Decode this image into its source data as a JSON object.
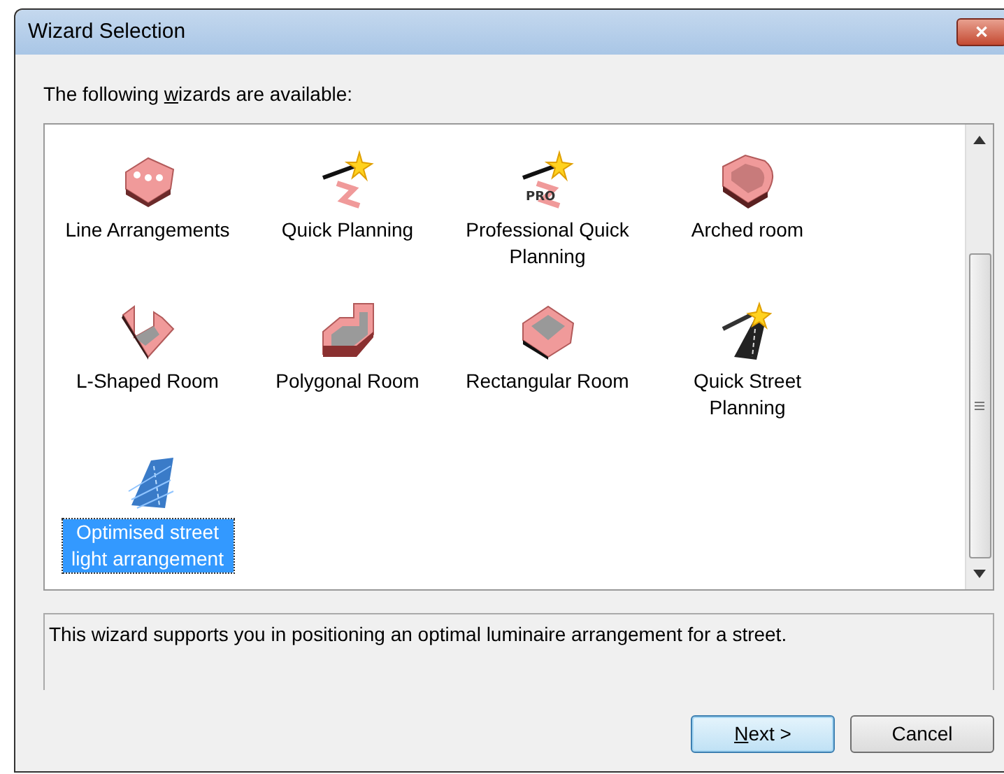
{
  "window": {
    "title": "Wizard Selection",
    "close": "✕"
  },
  "prompt": {
    "before": "The following ",
    "key": "w",
    "after": "izards are available:"
  },
  "wizards": [
    {
      "label": "Line Arrangements",
      "kind": "lit-box",
      "selected": false
    },
    {
      "label": "Quick Planning",
      "kind": "wand",
      "selected": false
    },
    {
      "label": "Professional Quick Planning",
      "kind": "wand",
      "badge": "PRO",
      "selected": false
    },
    {
      "label": "Arched room",
      "kind": "arched-room",
      "selected": false
    },
    {
      "label": "L-Shaped Room",
      "kind": "l-room",
      "selected": false
    },
    {
      "label": "Polygonal Room",
      "kind": "polygon-room",
      "selected": false
    },
    {
      "label": "Rectangular Room",
      "kind": "rect-room",
      "selected": false
    },
    {
      "label": "Quick Street Planning",
      "kind": "street-wand",
      "selected": false
    },
    {
      "label": "Optimised street light arrangement",
      "kind": "street-grid",
      "selected": true
    }
  ],
  "description": "This wizard supports you in positioning an optimal luminaire arrangement for a street.",
  "buttons": [
    {
      "key": "N",
      "after": "ext >",
      "default": true
    },
    {
      "after": "Cancel",
      "default": false
    }
  ]
}
